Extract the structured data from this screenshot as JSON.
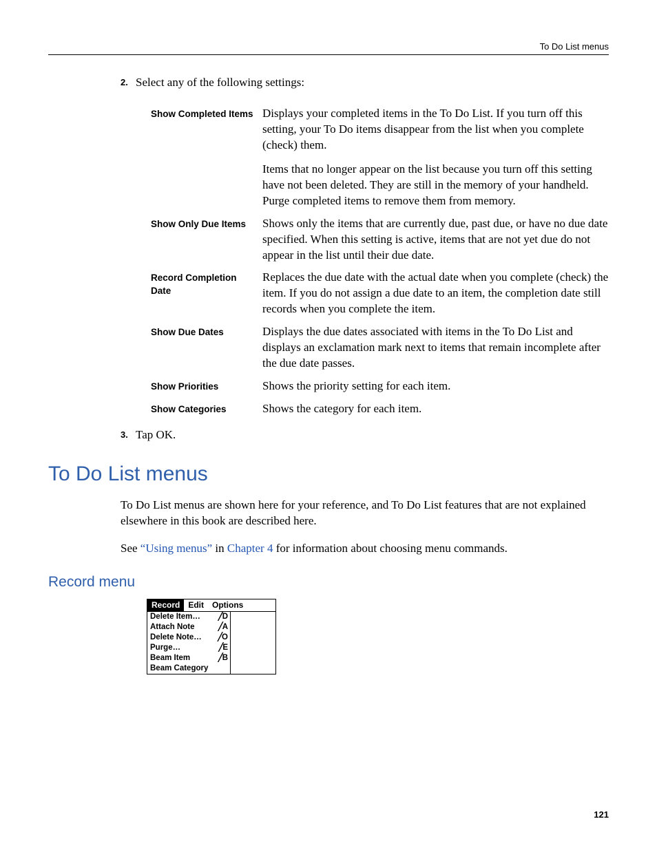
{
  "header": {
    "label": "To Do List menus"
  },
  "step2": {
    "num": "2.",
    "text": "Select any of the following settings:"
  },
  "settings": [
    {
      "label": "Show Completed Items",
      "paras": [
        "Displays your completed items in the To Do List. If you turn off this setting, your To Do items disappear from the list when you complete (check) them.",
        "Items that no longer appear on the list because you turn off this setting have not been deleted. They are still in the memory of your handheld. Purge completed items to remove them from memory."
      ]
    },
    {
      "label": "Show Only Due Items",
      "paras": [
        "Shows only the items that are currently due, past due, or have no due date specified. When this setting is active, items that are not yet due do not appear in the list until their due date."
      ]
    },
    {
      "label": "Record Completion Date",
      "paras": [
        "Replaces the due date with the actual date when you complete (check) the item. If you do not assign a due date to an item, the completion date still records when you complete the item."
      ]
    },
    {
      "label": "Show Due Dates",
      "paras": [
        "Displays the due dates associated with items in the To Do List and displays an exclamation mark next to items that remain incomplete after the due date passes."
      ]
    },
    {
      "label": "Show Priorities",
      "paras": [
        "Shows the priority setting for each item."
      ]
    },
    {
      "label": "Show Categories",
      "paras": [
        "Shows the category for each item."
      ]
    }
  ],
  "step3": {
    "num": "3.",
    "text": "Tap OK."
  },
  "section_h1": "To Do List menus",
  "intro_para": "To Do List menus are shown here for your reference, and To Do List features that are not explained elsewhere in this book are described here.",
  "see_pre": "See ",
  "see_link1": "“Using menus”",
  "see_mid": " in ",
  "see_link2": "Chapter 4",
  "see_post": " for information about choosing menu commands.",
  "subsection_h2": "Record menu",
  "menu": {
    "bar": [
      "Record",
      "Edit",
      "Options"
    ],
    "items": [
      {
        "label": "Delete Item…",
        "sc": "D"
      },
      {
        "label": "Attach Note",
        "sc": "A"
      },
      {
        "label": "Delete Note…",
        "sc": "O"
      },
      {
        "label": "Purge…",
        "sc": "E"
      },
      {
        "label": "Beam Item",
        "sc": "B"
      },
      {
        "label": "Beam Category",
        "sc": ""
      }
    ]
  },
  "page_number": "121"
}
